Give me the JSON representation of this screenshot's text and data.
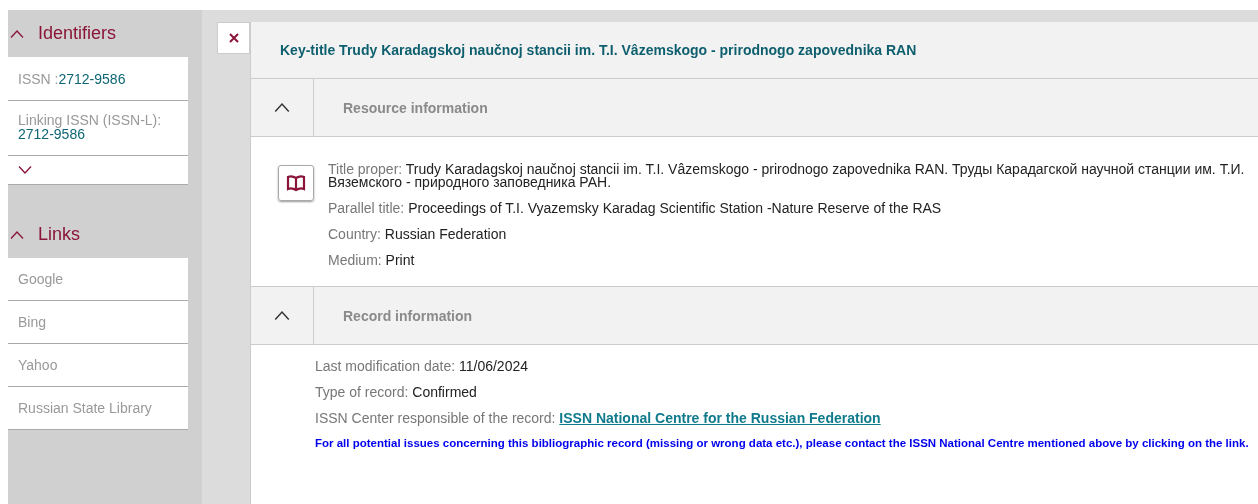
{
  "sidebar": {
    "identifiers": {
      "title": "Identifiers",
      "expanded": true,
      "items": [
        {
          "label": "ISSN :",
          "value": "2712-9586",
          "kind": "inline"
        },
        {
          "label": "Linking ISSN (ISSN-L):",
          "value": "2712-9586",
          "kind": "block"
        }
      ]
    },
    "links": {
      "title": "Links",
      "expanded": true,
      "items": [
        "Google",
        "Bing",
        "Yahoo",
        "Russian State Library"
      ]
    }
  },
  "record": {
    "key_title": "Key-title Trudy Karadagskoj naučnoj stancii im. T.I. Vâzemskogo - prirodnogo zapovednika RAN",
    "resource": {
      "title": "Resource information",
      "expanded": true,
      "fields": [
        {
          "label": "Title proper:",
          "value": "Trudy Karadagskoj naučnoj stancii im. T.I. Vâzemskogo - prirodnogo zapovednika RAN. Труды Карадагской научной станции им. Т.И. Вяземского - природного заповедника РАН."
        },
        {
          "label": "Parallel title:",
          "value": "Proceedings of T.I. Vyazemsky Karadag Scientific Station -Nature Reserve of the RAS"
        },
        {
          "label": "Country:",
          "value": "Russian Federation"
        },
        {
          "label": "Medium:",
          "value": "Print"
        }
      ]
    },
    "record_info": {
      "title": "Record information",
      "expanded": true,
      "fields": [
        {
          "label": "Last modification date:",
          "value": "11/06/2024",
          "kind": "text"
        },
        {
          "label": "Type of record:",
          "value": "Confirmed",
          "kind": "text"
        },
        {
          "label": "ISSN Center responsible of the record:",
          "value": "ISSN National Centre for the Russian Federation",
          "kind": "link"
        }
      ],
      "notice": "For all potential issues concerning this bibliographic record (missing or wrong data etc.), please contact the ISSN National Centre mentioned above by clicking on the link."
    }
  }
}
